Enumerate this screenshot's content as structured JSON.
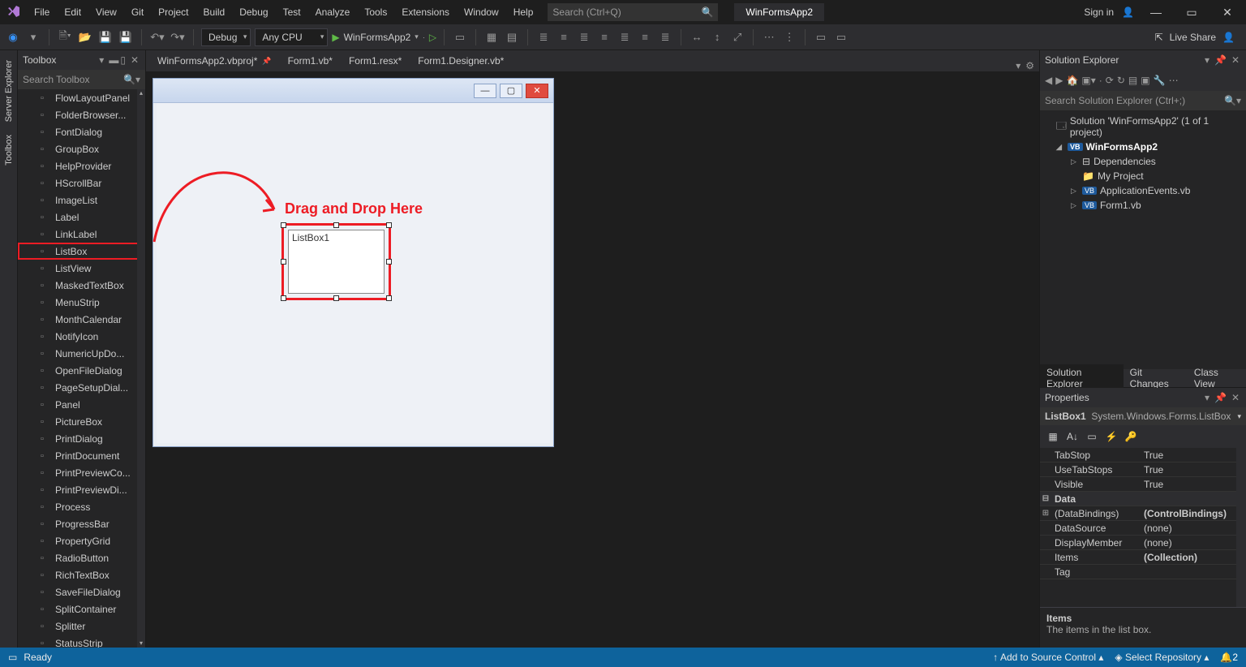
{
  "titlebar": {
    "menu": [
      "File",
      "Edit",
      "View",
      "Git",
      "Project",
      "Build",
      "Debug",
      "Test",
      "Analyze",
      "Tools",
      "Extensions",
      "Window",
      "Help"
    ],
    "search_placeholder": "Search (Ctrl+Q)",
    "app_name": "WinFormsApp2",
    "sign_in": "Sign in"
  },
  "toolbar": {
    "config": "Debug",
    "platform": "Any CPU",
    "start_target": "WinFormsApp2",
    "live_share": "Live Share"
  },
  "left_rail": {
    "server_explorer": "Server Explorer",
    "toolbox": "Toolbox"
  },
  "toolbox": {
    "title": "Toolbox",
    "search_placeholder": "Search Toolbox",
    "items": [
      "FlowLayoutPanel",
      "FolderBrowser...",
      "FontDialog",
      "GroupBox",
      "HelpProvider",
      "HScrollBar",
      "ImageList",
      "Label",
      "LinkLabel",
      "ListBox",
      "ListView",
      "MaskedTextBox",
      "MenuStrip",
      "MonthCalendar",
      "NotifyIcon",
      "NumericUpDo...",
      "OpenFileDialog",
      "PageSetupDial...",
      "Panel",
      "PictureBox",
      "PrintDialog",
      "PrintDocument",
      "PrintPreviewCo...",
      "PrintPreviewDi...",
      "Process",
      "ProgressBar",
      "PropertyGrid",
      "RadioButton",
      "RichTextBox",
      "SaveFileDialog",
      "SplitContainer",
      "Splitter",
      "StatusStrip"
    ],
    "highlight_index": 9
  },
  "doc_tabs": [
    "WinFormsApp2.vbproj*",
    "Form1.vb*",
    "Form1.resx*",
    "Form1.Designer.vb*"
  ],
  "designer": {
    "listbox_label": "ListBox1",
    "annotation": "Drag and Drop Here"
  },
  "solution_explorer": {
    "title": "Solution Explorer",
    "search_placeholder": "Search Solution Explorer (Ctrl+;)",
    "solution_line": "Solution 'WinFormsApp2' (1 of 1 project)",
    "project": "WinFormsApp2",
    "dependencies": "Dependencies",
    "my_project": "My Project",
    "app_events": "ApplicationEvents.vb",
    "form1": "Form1.vb",
    "bottom_tabs": [
      "Solution Explorer",
      "Git Changes",
      "Class View"
    ]
  },
  "properties": {
    "title": "Properties",
    "selector_name": "ListBox1",
    "selector_type": "System.Windows.Forms.ListBox",
    "rows": [
      {
        "kind": "prop",
        "name": "TabStop",
        "val": "True"
      },
      {
        "kind": "prop",
        "name": "UseTabStops",
        "val": "True"
      },
      {
        "kind": "prop",
        "name": "Visible",
        "val": "True"
      },
      {
        "kind": "cat",
        "name": "Data"
      },
      {
        "kind": "prop",
        "name": "(DataBindings)",
        "val": "(ControlBindings)",
        "bold": true,
        "expand": "⊞"
      },
      {
        "kind": "prop",
        "name": "DataSource",
        "val": "(none)"
      },
      {
        "kind": "prop",
        "name": "DisplayMember",
        "val": "(none)"
      },
      {
        "kind": "prop",
        "name": "Items",
        "val": "(Collection)",
        "bold": true
      },
      {
        "kind": "prop",
        "name": "Tag",
        "val": ""
      }
    ],
    "desc_name": "Items",
    "desc_text": "The items in the list box."
  },
  "statusbar": {
    "ready": "Ready",
    "add_source": "Add to Source Control",
    "select_repo": "Select Repository",
    "notif_count": "2"
  }
}
